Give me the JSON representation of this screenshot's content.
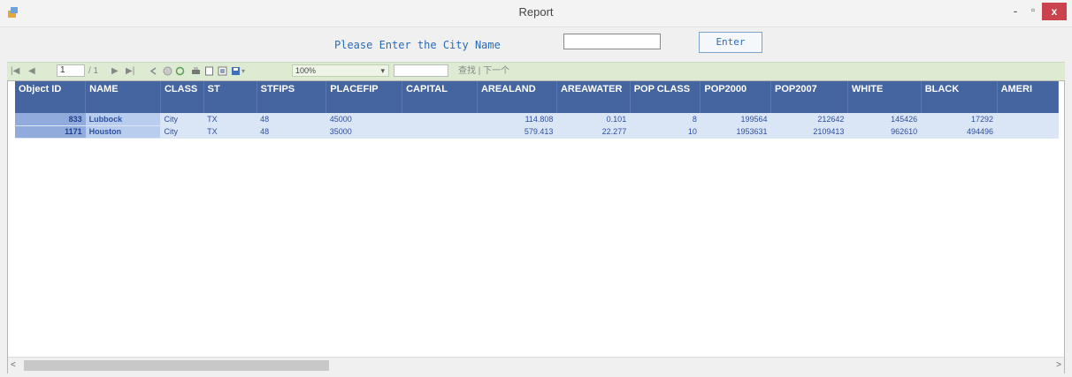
{
  "window": {
    "title": "Report",
    "minimize_glyph": "-",
    "maximize_glyph": "▫",
    "close_glyph": "x",
    "close_color": "#c9424d"
  },
  "form": {
    "prompt": "Please Enter the City Name",
    "city_value": "",
    "enter_label": "Enter"
  },
  "toolbar": {
    "first_glyph": "|◀",
    "prev_glyph": "◀",
    "page_value": "1",
    "page_of": "/ 1",
    "next_glyph": "▶",
    "last_glyph": "▶|",
    "zoom_value": "100%",
    "zoom_arrow": "▾",
    "find_value": "",
    "find_next_label": "查找 | 下一个",
    "background": "#dcebd2"
  },
  "table": {
    "headers": [
      "Object ID",
      "NAME",
      "CLASS",
      "ST",
      "STFIPS",
      "PLACEFIP",
      "CAPITAL",
      "AREALAND",
      "AREAWATER",
      "POP CLASS",
      "POP2000",
      "POP2007",
      "WHITE",
      "BLACK",
      "AMERI"
    ],
    "rows": [
      [
        "833",
        "Lubbock",
        "City",
        "TX",
        "48",
        "45000",
        "",
        "114.808",
        "0.101",
        "8",
        "199564",
        "212642",
        "145426",
        "17292",
        ""
      ],
      [
        "1171",
        "Houston",
        "City",
        "TX",
        "48",
        "35000",
        "",
        "579.413",
        "22.277",
        "10",
        "1953631",
        "2109413",
        "962610",
        "494496",
        ""
      ]
    ],
    "header_color": "#4565a0"
  },
  "scroll": {
    "left_glyph": "<",
    "right_glyph": ">"
  }
}
